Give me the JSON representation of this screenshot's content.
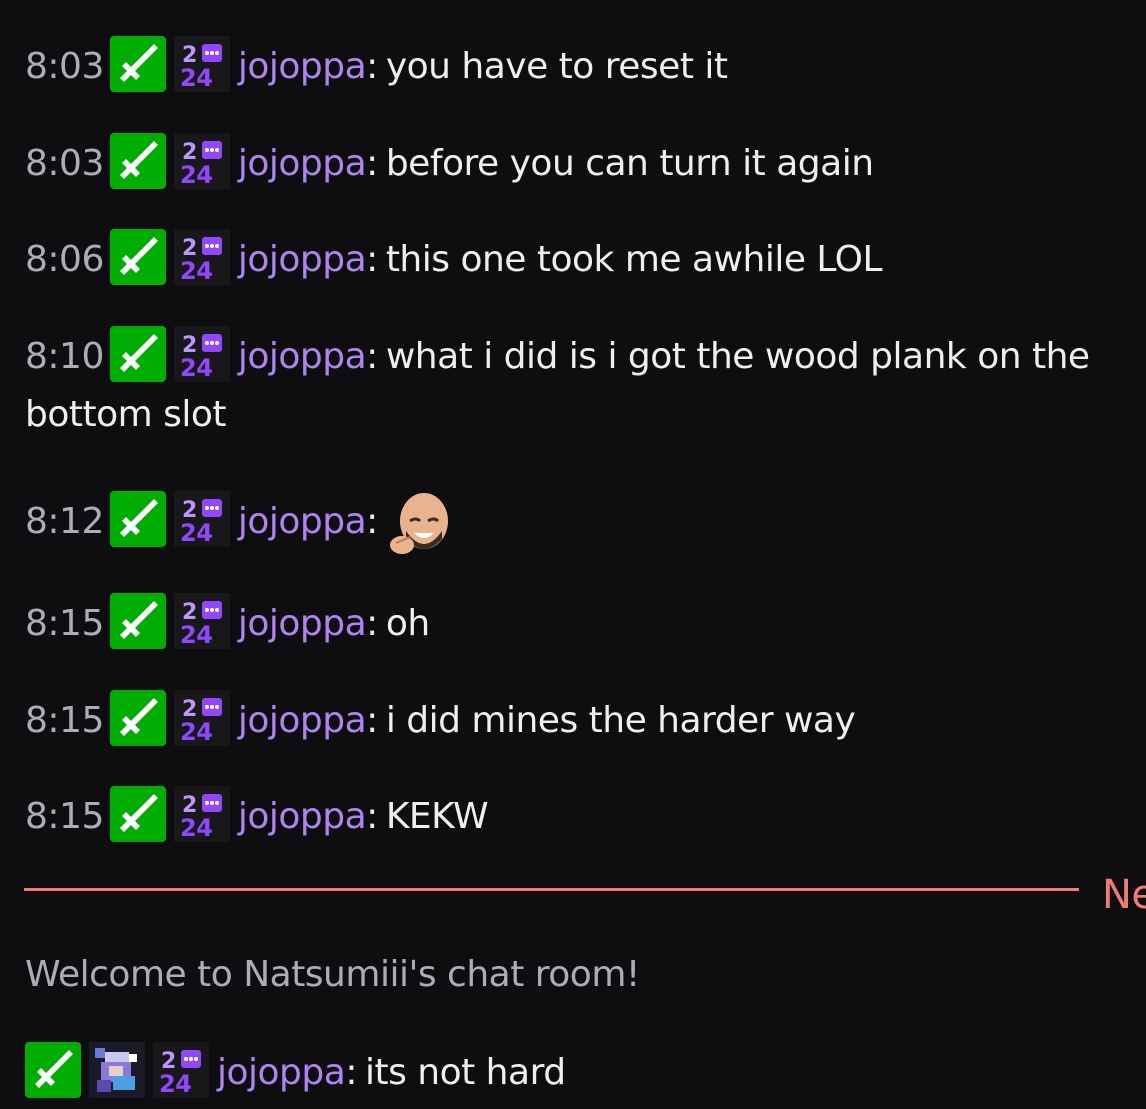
{
  "chat": {
    "messages": [
      {
        "time": "8:03",
        "user": "jojoppa",
        "text": "you have to reset it"
      },
      {
        "time": "8:03",
        "user": "jojoppa",
        "text": "before you can turn it again"
      },
      {
        "time": "8:06",
        "user": "jojoppa",
        "text": "this one took me awhile LOL"
      },
      {
        "time": "8:10",
        "user": "jojoppa",
        "text": "what i did is i got the wood plank on the bottom slot"
      },
      {
        "time": "8:12",
        "user": "jojoppa",
        "text": "",
        "emote": "laughing-man-emote"
      },
      {
        "time": "8:15",
        "user": "jojoppa",
        "text": "oh"
      },
      {
        "time": "8:15",
        "user": "jojoppa",
        "text": "i did mines the harder way"
      },
      {
        "time": "8:15",
        "user": "jojoppa",
        "text": "KEKW"
      }
    ],
    "divider_label": "Ne",
    "system_message": "Welcome to Natsumiii's chat room!",
    "last_message": {
      "user": "jojoppa",
      "text": "its not hard"
    }
  },
  "badges": {
    "moderator": {
      "icon": "sword-icon",
      "color": "#00ad03"
    },
    "sub_gift": {
      "icon": "2024-badge-icon",
      "color": "#9147ff"
    },
    "avatar": {
      "icon": "anime-badge-icon"
    }
  },
  "colors": {
    "background": "#0e0e10",
    "timestamp": "#adadb8",
    "username": "#b083f0",
    "divider": "#f17b76"
  }
}
